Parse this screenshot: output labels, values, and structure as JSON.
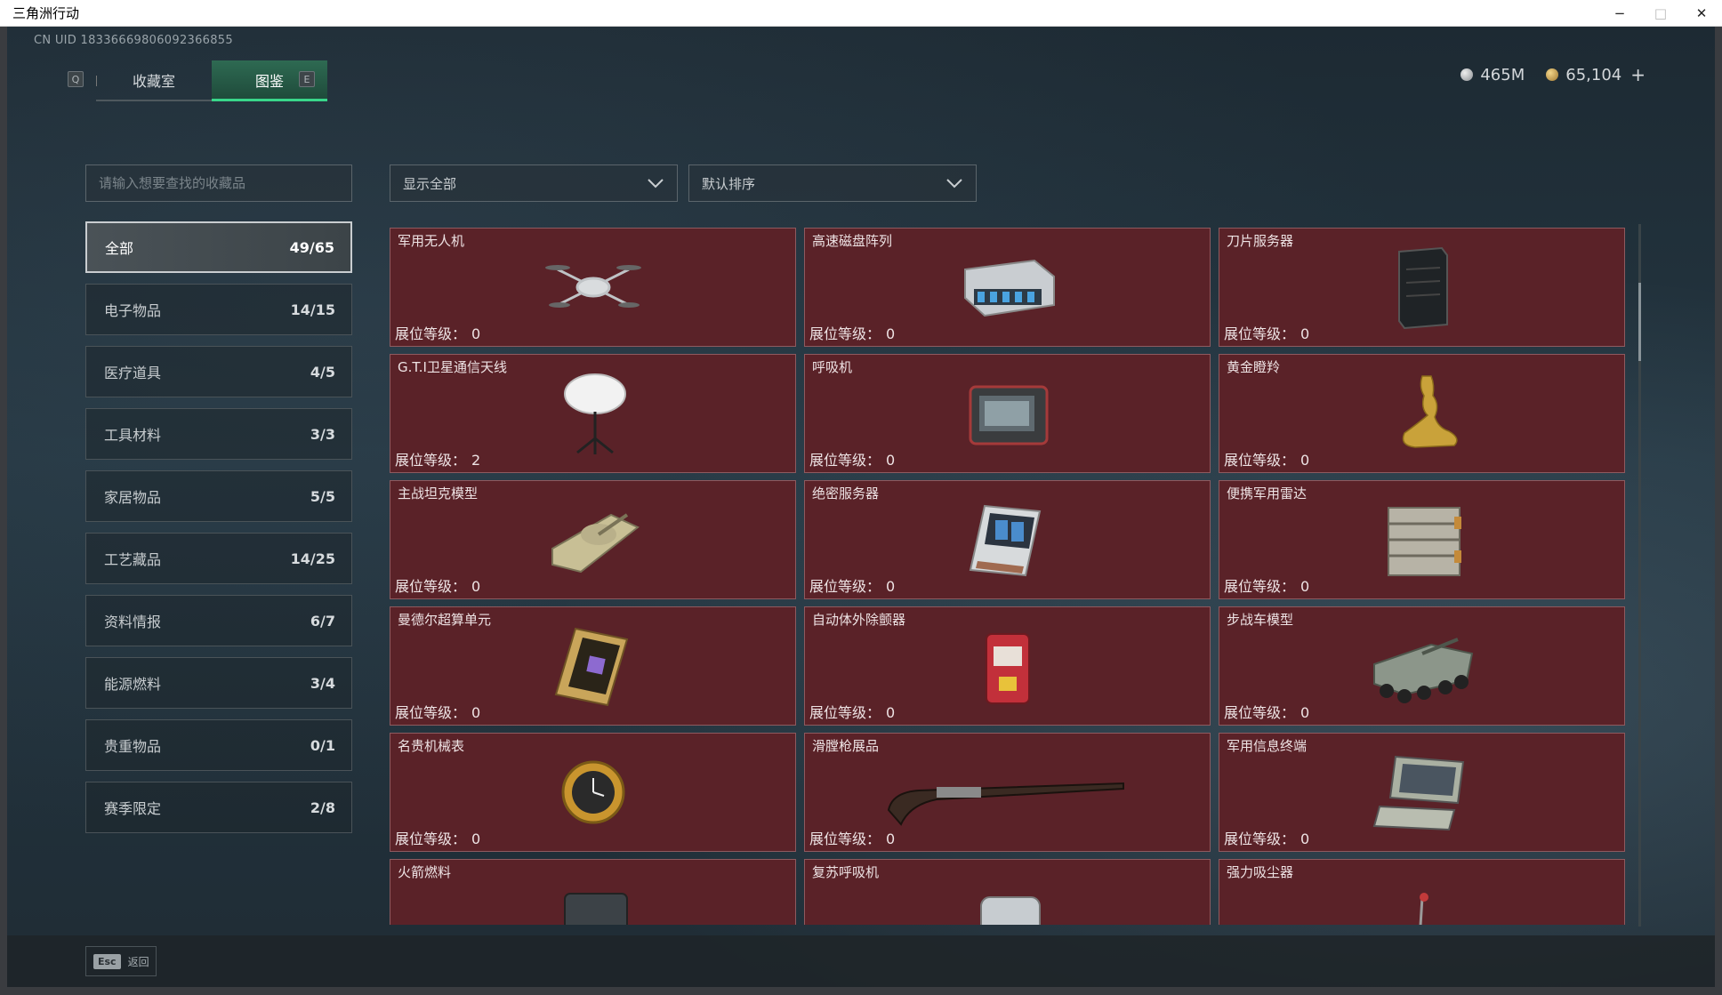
{
  "window": {
    "title": "三角洲行动",
    "minimize": "−",
    "maximize": "□",
    "close": "✕"
  },
  "uid": "CN UID 18336669806092366855",
  "currency": {
    "silver": "465M",
    "gold": "65,104",
    "add": "+"
  },
  "tabs": {
    "left_key": "Q",
    "right_key": "E",
    "items": [
      {
        "label": "收藏室",
        "active": false
      },
      {
        "label": "图鉴",
        "active": true
      }
    ]
  },
  "search": {
    "placeholder": "请输入想要查找的收藏品"
  },
  "filters": {
    "show": "显示全部",
    "sort": "默认排序"
  },
  "sidebar": {
    "items": [
      {
        "label": "全部",
        "count": "49/65"
      },
      {
        "label": "电子物品",
        "count": "14/15"
      },
      {
        "label": "医疗道具",
        "count": "4/5"
      },
      {
        "label": "工具材料",
        "count": "3/3"
      },
      {
        "label": "家居物品",
        "count": "5/5"
      },
      {
        "label": "工艺藏品",
        "count": "14/25"
      },
      {
        "label": "资料情报",
        "count": "6/7"
      },
      {
        "label": "能源燃料",
        "count": "3/4"
      },
      {
        "label": "贵重物品",
        "count": "0/1"
      },
      {
        "label": "赛季限定",
        "count": "2/8"
      }
    ]
  },
  "level_label": "展位等级：",
  "cards": [
    {
      "name": "军用无人机",
      "level": "0",
      "icon": "drone-icon"
    },
    {
      "name": "高速磁盘阵列",
      "level": "0",
      "icon": "disk-array-icon"
    },
    {
      "name": "刀片服务器",
      "level": "0",
      "icon": "blade-server-icon"
    },
    {
      "name": "G.T.I卫星通信天线",
      "level": "2",
      "icon": "satellite-dish-icon"
    },
    {
      "name": "呼吸机",
      "level": "0",
      "icon": "ventilator-icon"
    },
    {
      "name": "黄金瞪羚",
      "level": "0",
      "icon": "golden-gazelle-icon"
    },
    {
      "name": "主战坦克模型",
      "level": "0",
      "icon": "tank-model-icon"
    },
    {
      "name": "绝密服务器",
      "level": "0",
      "icon": "secret-server-icon"
    },
    {
      "name": "便携军用雷达",
      "level": "0",
      "icon": "portable-radar-icon"
    },
    {
      "name": "曼德尔超算单元",
      "level": "0",
      "icon": "supercomputer-unit-icon"
    },
    {
      "name": "自动体外除颤器",
      "level": "0",
      "icon": "defibrillator-icon"
    },
    {
      "name": "步战车模型",
      "level": "0",
      "icon": "ifv-model-icon"
    },
    {
      "name": "名贵机械表",
      "level": "0",
      "icon": "mechanical-watch-icon"
    },
    {
      "name": "滑膛枪展品",
      "level": "0",
      "icon": "musket-icon"
    },
    {
      "name": "军用信息终端",
      "level": "0",
      "icon": "info-terminal-icon"
    },
    {
      "name": "火箭燃料",
      "level": "",
      "icon": "rocket-fuel-icon"
    },
    {
      "name": "复苏呼吸机",
      "level": "",
      "icon": "resuscitator-icon"
    },
    {
      "name": "强力吸尘器",
      "level": "",
      "icon": "vacuum-icon"
    }
  ],
  "footer": {
    "esc_key": "Esc",
    "back": "返回"
  },
  "colors": {
    "card_bg": "#5a2228",
    "tab_active": "#2e6a52",
    "tab_accent": "#39d68a"
  }
}
